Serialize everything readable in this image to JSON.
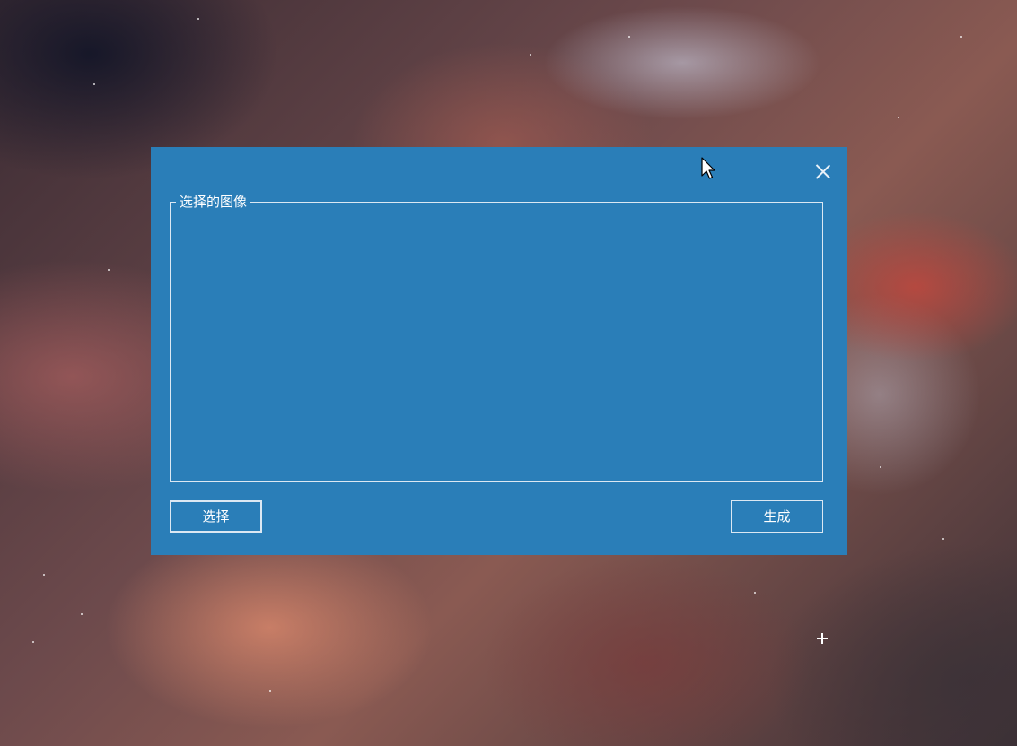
{
  "dialog": {
    "group_title": "选择的图像",
    "select_button_label": "选择",
    "generate_button_label": "生成",
    "close_icon": "close-icon"
  },
  "colors": {
    "dialog_background": "#2a7eb8",
    "border": "#dbe8f3",
    "text": "#ffffff"
  }
}
